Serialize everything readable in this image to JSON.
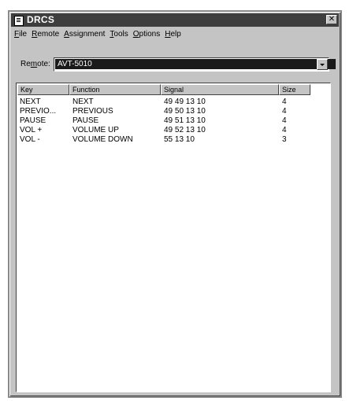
{
  "window": {
    "title": "DRCS",
    "close_glyph": "✕"
  },
  "menu": [
    {
      "underline": "F",
      "rest": "ile"
    },
    {
      "underline": "R",
      "rest": "emote"
    },
    {
      "underline": "A",
      "rest": "ssignment"
    },
    {
      "underline": "T",
      "rest": "ools"
    },
    {
      "underline": "O",
      "rest": "ptions"
    },
    {
      "underline": "H",
      "rest": "elp"
    }
  ],
  "remote": {
    "label_pre": "Re",
    "label_ul": "m",
    "label_post": "ote:",
    "value": "AVT-5010"
  },
  "list": {
    "headers": [
      {
        "label": "Key"
      },
      {
        "label": "Function"
      },
      {
        "label": "Signal"
      },
      {
        "label": "Size"
      }
    ],
    "rows": [
      {
        "key": "NEXT",
        "function": "NEXT",
        "signal": "49 49 13 10",
        "size": "4"
      },
      {
        "key": "PREVIO...",
        "function": "PREVIOUS",
        "signal": "49 50 13 10",
        "size": "4"
      },
      {
        "key": "PAUSE",
        "function": "PAUSE",
        "signal": "49 51 13 10",
        "size": "4"
      },
      {
        "key": "VOL +",
        "function": "VOLUME UP",
        "signal": "49 52 13 10",
        "size": "4"
      },
      {
        "key": "VOL -",
        "function": "VOLUME DOWN",
        "signal": "55 13 10",
        "size": "3"
      }
    ]
  },
  "icons": {
    "app": "remote-app-icon",
    "close": "close-icon",
    "dropdown": "chevron-down-icon"
  }
}
